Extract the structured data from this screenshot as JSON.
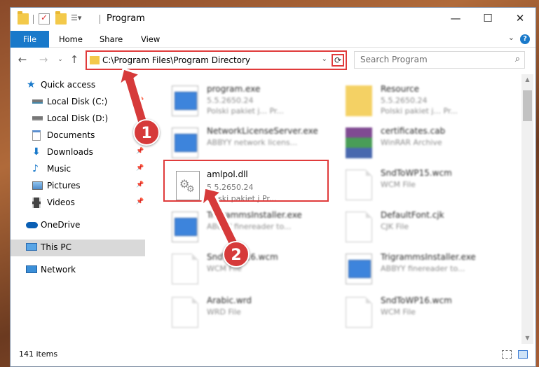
{
  "window": {
    "title": "Program",
    "controls": {
      "minimize": "—",
      "maximize": "☐",
      "close": "✕"
    }
  },
  "ribbon": {
    "file": "File",
    "tabs": [
      "Home",
      "Share",
      "View"
    ]
  },
  "address_bar": {
    "path": "C:\\Program Files\\Program Directory",
    "refresh_icon": "⟳"
  },
  "search": {
    "placeholder": "Search Program"
  },
  "sidebar": {
    "items": [
      {
        "label": "Quick access",
        "icon": "star-icon"
      },
      {
        "label": "Local Disk (C:)",
        "icon": "drive-icon"
      },
      {
        "label": "Local Disk (D:)",
        "icon": "drive-icon"
      },
      {
        "label": "Documents",
        "icon": "documents-icon"
      },
      {
        "label": "Downloads",
        "icon": "download-icon"
      },
      {
        "label": "Music",
        "icon": "music-icon"
      },
      {
        "label": "Pictures",
        "icon": "pictures-icon"
      },
      {
        "label": "Videos",
        "icon": "videos-icon"
      },
      {
        "label": "OneDrive",
        "icon": "cloud-icon"
      },
      {
        "label": "This PC",
        "icon": "computer-icon"
      },
      {
        "label": "Network",
        "icon": "network-icon"
      }
    ]
  },
  "files": [
    {
      "name": "program.exe",
      "line2": "5.5.2650.24",
      "line3": "Polski pakiet j... Pr..."
    },
    {
      "name": "Resource",
      "line2": "5.5.2650.24",
      "line3": "Polski pakiet j... Pr..."
    },
    {
      "name": "NetworkLicenseServer.exe",
      "line2": "ABBYY network licens..."
    },
    {
      "name": "certificates.cab",
      "line2": "WinRAR Archive"
    },
    {
      "name": "amlpol.dll",
      "line2": "5.5.2650.24",
      "line3": "Polski pakiet j   Pr..."
    },
    {
      "name": "SndToWP15.wcm",
      "line2": "WCM File"
    },
    {
      "name": "TrigrammsInstaller.exe",
      "line2": "ABBYY finereader to..."
    },
    {
      "name": "DefaultFont.cjk",
      "line2": "CJK File"
    },
    {
      "name": "SndToWP16.wcm",
      "line2": "WCM File"
    },
    {
      "name": "TrigrammsInstaller.exe",
      "line2": "ABBYY finereader to..."
    },
    {
      "name": "Arabic.wrd",
      "line2": "WRD File"
    },
    {
      "name": "SndToWP16.wcm",
      "line2": "WCM File"
    }
  ],
  "status": {
    "item_count": "141 items"
  },
  "annotations": {
    "step1": "1",
    "step2": "2"
  },
  "colors": {
    "accent": "#1979ca",
    "highlight": "#e03b3b",
    "selected_nav": "#d9d9d9"
  }
}
